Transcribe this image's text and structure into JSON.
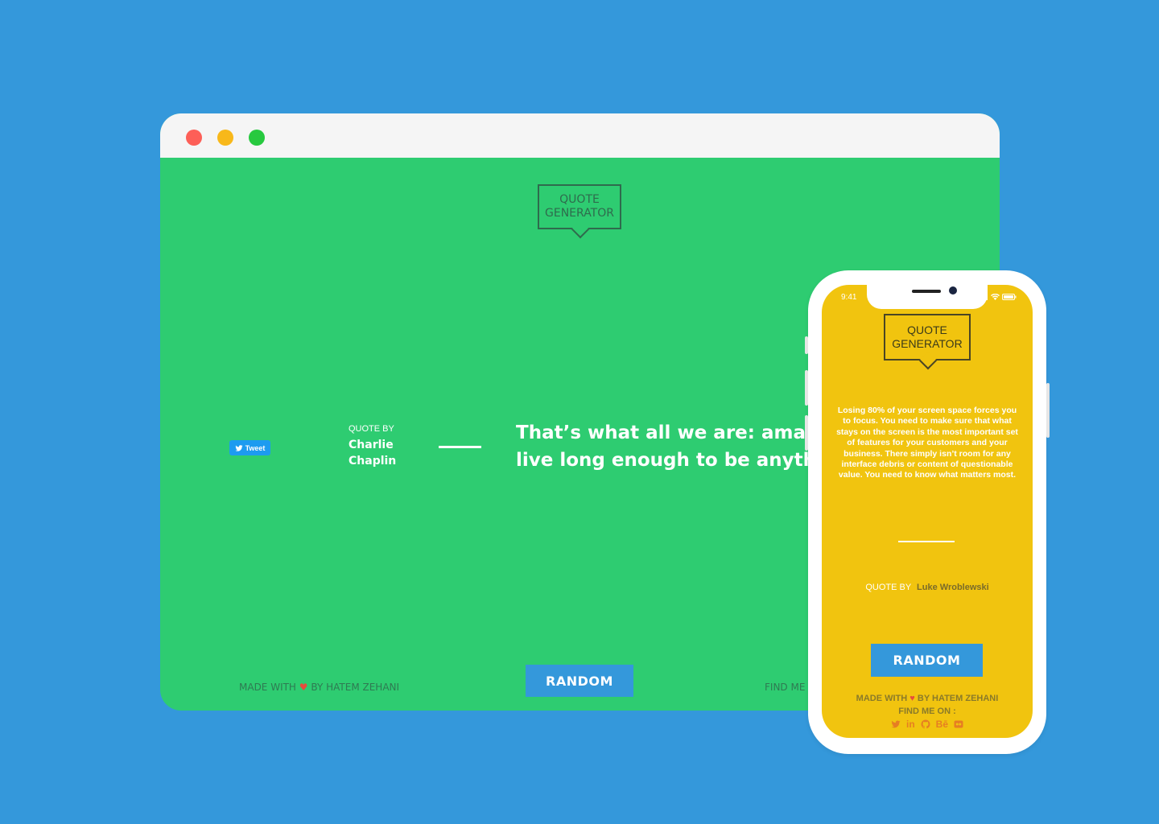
{
  "colors": {
    "background": "#3498db",
    "desktop_bg": "#2ecc71",
    "mobile_bg": "#f1c40f",
    "button": "#3498db",
    "heart": "#e74c3c",
    "social": "#e67e22"
  },
  "desktop": {
    "logo_line1": "QUOTE",
    "logo_line2": "GENERATOR",
    "tweet_label": "Tweet",
    "quote_by_label": "QUOTE BY",
    "author_first": "Charlie",
    "author_last": "Chaplin",
    "quote_line1": "That’s what all we are: amateu",
    "quote_line2": "live long enough to be anythin",
    "footer_made_prefix": "MADE WITH",
    "footer_made_suffix": "BY HATEM ZEHANI",
    "random_label": "RANDOM",
    "footer_find": "FIND ME"
  },
  "mobile": {
    "time": "9:41",
    "logo_line1": "QUOTE",
    "logo_line2": "GENERATOR",
    "quote": "Losing 80% of your screen space forces you to focus. You need to make sure that what stays on the screen is the most important set of features for your customers and your business. There simply isn’t room for any interface debris or content of questionable value. You need to know what matters most.",
    "quote_by_label": "QUOTE BY",
    "author": "Luke Wroblewski",
    "random_label": "RANDOM",
    "footer_made_prefix": "MADE WITH",
    "footer_made_suffix": "BY HATEM ZEHANI",
    "footer_find": "FIND ME ON :",
    "social_icons": [
      "twitter-icon",
      "linkedin-icon",
      "github-icon",
      "behance-icon",
      "flickr-icon"
    ],
    "social_labels": {
      "linkedin": "in",
      "behance": "Bē"
    }
  }
}
